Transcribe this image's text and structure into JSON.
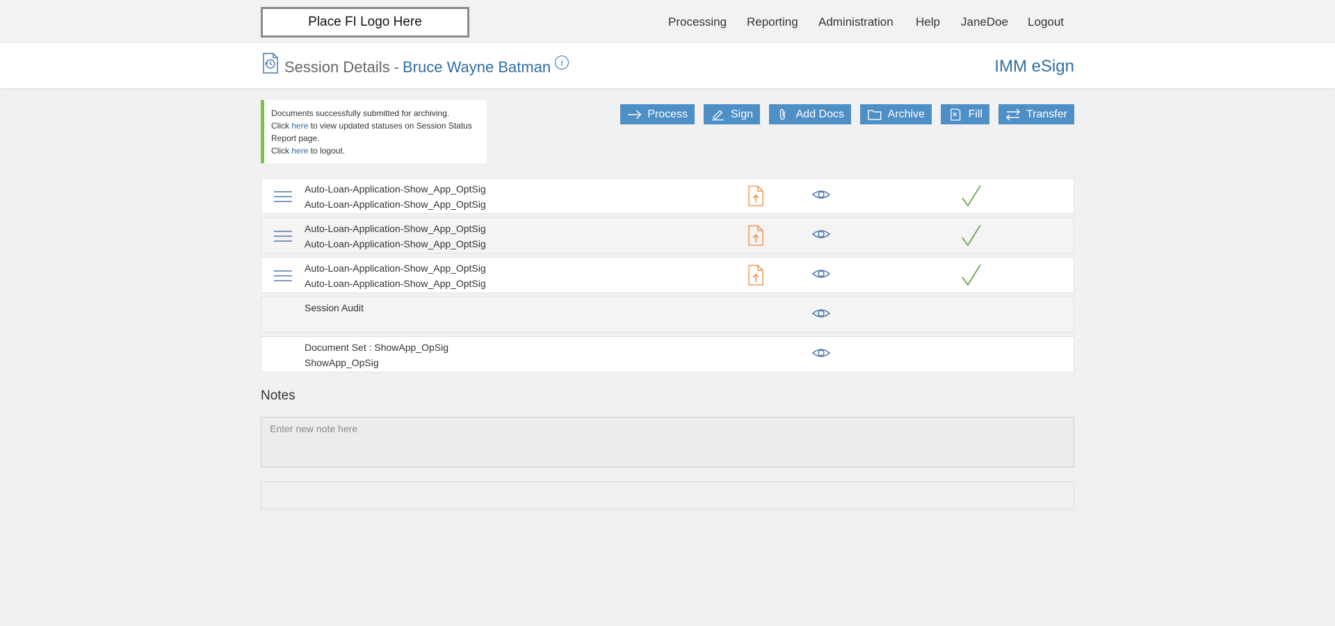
{
  "topbar": {
    "logo_text": "Place FI Logo Here",
    "nav": [
      "Processing",
      "Reporting",
      "Administration",
      "Help",
      "JaneDoe",
      "Logout"
    ]
  },
  "header": {
    "title": "Session Details -",
    "customer_name": "Bruce Wayne Batman",
    "info": "i",
    "app_name": "IMM eSign"
  },
  "alert": {
    "line1": "Documents successfully submitted for archiving.",
    "line2_pre": "Click ",
    "line2_link": "here",
    "line2_post": " to view updated statuses on Session Status Report page.",
    "line3_pre": "Click ",
    "line3_link": "here",
    "line3_post": " to logout."
  },
  "toolbar": {
    "process": "Process",
    "sign": "Sign",
    "add_docs": "Add Docs",
    "archive": "Archive",
    "fill": "Fill",
    "transfer": "Transfer"
  },
  "documents": [
    {
      "line1": "Auto-Loan-Application-Show_App_OptSig",
      "line2": "Auto-Loan-Application-Show_App_OptSig"
    },
    {
      "line1": "Auto-Loan-Application-Show_App_OptSig",
      "line2": "Auto-Loan-Application-Show_App_OptSig"
    },
    {
      "line1": "Auto-Loan-Application-Show_App_OptSig",
      "line2": "Auto-Loan-Application-Show_App_OptSig"
    },
    {
      "line1": "Session Audit",
      "line2": ""
    },
    {
      "line1": "Document Set : ShowApp_OpSig",
      "line2": "ShowApp_OpSig"
    }
  ],
  "notes": {
    "title": "Notes",
    "placeholder": "Enter new note here"
  },
  "colors": {
    "accent": "#4e8fc6",
    "link": "#2f6ea3",
    "success": "#7cc243",
    "doc_icon": "#f0883e"
  }
}
